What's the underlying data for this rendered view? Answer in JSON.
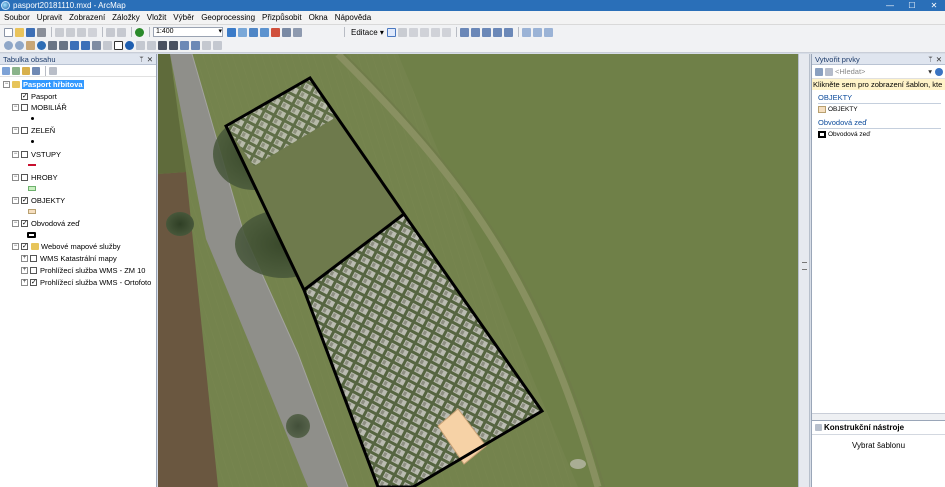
{
  "window": {
    "title": "pasport20181110.mxd - ArcMap",
    "minimize": "—",
    "maximize": "☐",
    "close": "✕"
  },
  "menu": [
    "Soubor",
    "Upravit",
    "Zobrazení",
    "Záložky",
    "Vložit",
    "Výběr",
    "Geoprocessing",
    "Přizpůsobit",
    "Okna",
    "Nápověda"
  ],
  "toolbar": {
    "scale": "1:400",
    "editace": "Editace ▾"
  },
  "toc": {
    "title": "Tabulka obsahu",
    "root": "Pasport hřbitova",
    "layers": [
      {
        "label": "Pasport",
        "checked": true
      },
      {
        "label": "MOBILIÁŘ",
        "checked": false
      },
      {
        "label": "ZELEŇ",
        "checked": false
      },
      {
        "label": "VSTUPY",
        "checked": false
      },
      {
        "label": "HROBY",
        "checked": false
      },
      {
        "label": "OBJEKTY",
        "checked": true
      },
      {
        "label": "Obvodová zeď",
        "checked": true
      },
      {
        "label": "Webové mapové služby",
        "checked": true
      },
      {
        "label": "WMS Katastrální mapy",
        "checked": false
      },
      {
        "label": "Prohlížecí služba WMS - ZM 10",
        "checked": false
      },
      {
        "label": "Prohlížecí služba WMS - Ortofoto",
        "checked": true
      }
    ]
  },
  "create_features": {
    "title": "Vytvořit prvky",
    "search_placeholder": "<Hledat>",
    "hint": "Klikněte sem pro zobrazení šablon, kte",
    "groups": [
      {
        "title": "OBJEKTY",
        "templates": [
          {
            "label": "OBJEKTY"
          }
        ]
      },
      {
        "title": "Obvodová zeď",
        "templates": [
          {
            "label": "Obvodová zeď"
          }
        ]
      }
    ]
  },
  "construction_tools": {
    "title": "Konstrukční nástroje",
    "body": "Vybrat šablonu"
  },
  "colors": {
    "title_bar": "#2a6fb8",
    "selection": "#3399ff",
    "vstupy_line": "#c8102e",
    "hroby_fill": "#c9f0c0",
    "objekty_fill": "#f6dfc0",
    "building": "#f6d2a6"
  }
}
